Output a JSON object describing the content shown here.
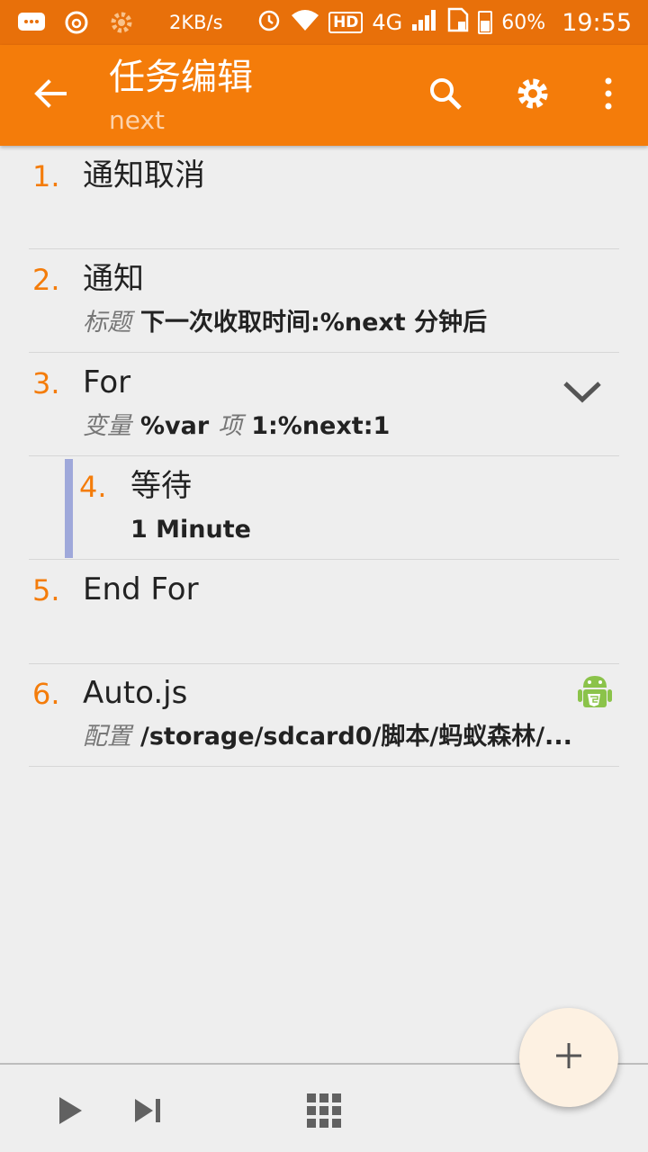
{
  "status_bar": {
    "speed": "2KB/s",
    "hd": "HD",
    "network": "4G",
    "battery": "60%",
    "time": "19:55",
    "icons": [
      "chat-icon",
      "netease-music-icon",
      "settings-app-icon",
      "alarm-icon",
      "wifi-icon",
      "signal-icon",
      "sim-icon",
      "battery-icon"
    ]
  },
  "app_bar": {
    "title": "任务编辑",
    "subtitle": "next",
    "icons": [
      "back-arrow-icon",
      "search-icon",
      "gear-icon",
      "more-vert-icon"
    ]
  },
  "actions": [
    {
      "number": "1.",
      "name": "通知取消",
      "details": []
    },
    {
      "number": "2.",
      "name": "通知",
      "details": [
        {
          "label": "标题",
          "value": "下一次收取时间:%next 分钟后"
        }
      ]
    },
    {
      "number": "3.",
      "name": "For",
      "details": [
        {
          "label": "变量",
          "value": "%var"
        },
        {
          "label": "项",
          "value": "1:%next:1"
        }
      ],
      "icon": "chevron-down-icon"
    },
    {
      "number": "4.",
      "name": "等待",
      "details": [
        {
          "label": "",
          "value": "1 Minute"
        }
      ],
      "nested": true
    },
    {
      "number": "5.",
      "name": "End For",
      "details": []
    },
    {
      "number": "6.",
      "name": "Auto.js",
      "details": [
        {
          "label": "配置",
          "value": "/storage/sdcard0/脚本/蚂蚁森林/..."
        }
      ],
      "icon": "android-plugin-icon"
    }
  ],
  "bottom_bar": {
    "icons": [
      "play-icon",
      "skip-next-icon",
      "grid-icon"
    ]
  },
  "fab": {
    "icon": "plus-icon"
  },
  "colors": {
    "primary": "#f47c0a",
    "status": "#e8700a",
    "nest_bar": "#9fa8da"
  }
}
